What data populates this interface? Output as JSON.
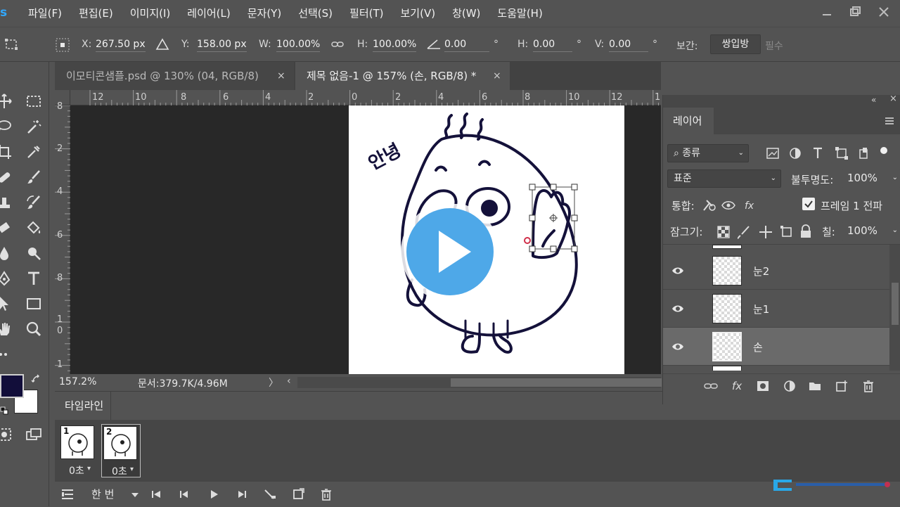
{
  "menubar": {
    "logo": "s",
    "items": [
      "파일(F)",
      "편집(E)",
      "이미지(I)",
      "레이어(L)",
      "문자(Y)",
      "선택(S)",
      "필터(T)",
      "보기(V)",
      "창(W)",
      "도움말(H)"
    ]
  },
  "options": {
    "x_label": "X:",
    "x_value": "267.50 px",
    "y_label": "Y:",
    "y_value": "158.00 px",
    "w_label": "W:",
    "w_value": "100.00%",
    "h_label": "H:",
    "h_value": "100.00%",
    "angle_value": "0.00",
    "degree_symbol": "°",
    "hskew_label": "H:",
    "hskew_value": "0.00",
    "vskew_label": "V:",
    "vskew_value": "0.00",
    "interp_label": "보간:",
    "interp_button": "쌍입방",
    "interp_value": "필수"
  },
  "tabs": [
    {
      "label": "이모티콘샘플.psd @ 130% (04, RGB/8)",
      "close": "×"
    },
    {
      "label": "제목 없음-1 @ 157% (손, RGB/8) *",
      "close": "×"
    }
  ],
  "ruler_h": [
    "12",
    "10",
    "8",
    "6",
    "4",
    "2",
    "0",
    "2",
    "4",
    "6",
    "8",
    "10",
    "12",
    "1"
  ],
  "ruler_v": [
    "8",
    "2",
    "4",
    "6",
    "8",
    "1",
    "0",
    "1"
  ],
  "canvas": {
    "greeting": "안녕"
  },
  "status": {
    "zoom": "157.2%",
    "doc_info": "문서:379.7K/4.96M",
    "arrow_right": "〉",
    "arrow_left": "‹"
  },
  "timeline": {
    "tab": "타임라인",
    "frames": [
      {
        "number": "1",
        "duration": "0초",
        "selected": false
      },
      {
        "number": "2",
        "duration": "0초",
        "selected": true
      }
    ],
    "loop": "한 번"
  },
  "layers": {
    "tab": "레이어",
    "filter_kind": "종류",
    "blend_mode": "표준",
    "opacity_label": "불투명도:",
    "opacity_value": "100%",
    "unify_label": "통합:",
    "propagate_label": "프레임 1 전파",
    "lock_label": "잠그기:",
    "fill_label": "칠:",
    "fill_value": "100%",
    "items": [
      {
        "name": "눈2",
        "selected": false
      },
      {
        "name": "눈1",
        "selected": false
      },
      {
        "name": "손",
        "selected": true
      }
    ]
  },
  "colors": {
    "foreground": "#120e3a",
    "background": "#ffffff",
    "play_button": "#4ea8e8",
    "selection_dot": "#d0304a"
  }
}
